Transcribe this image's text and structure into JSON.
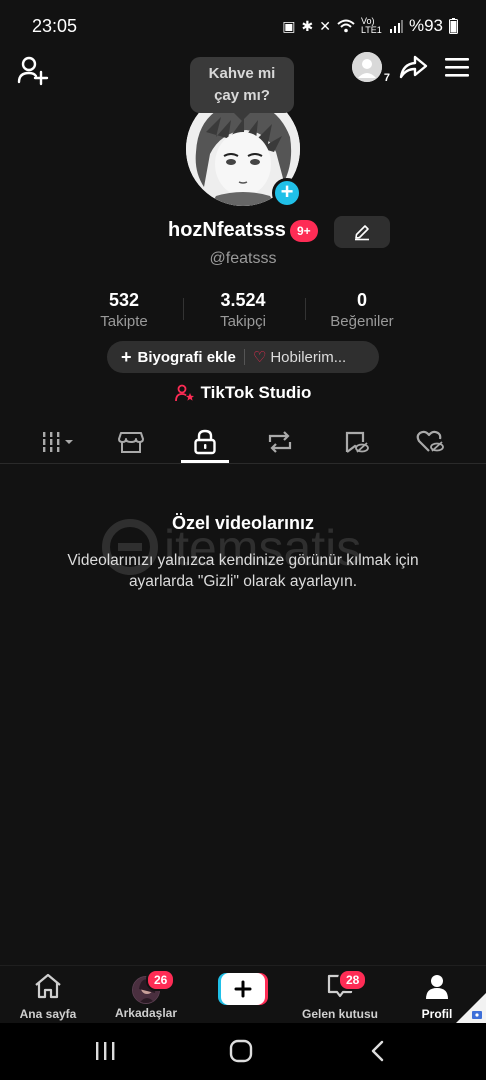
{
  "status": {
    "time": "23:05",
    "network": "Vo) LTE1",
    "battery": "%93"
  },
  "top_bar": {
    "mini_avatar_count": "7"
  },
  "tooltip": {
    "line1": "Kahve mi",
    "line2": "çay mı?"
  },
  "profile": {
    "username": "hozNfeatsss",
    "notif_badge": "9+",
    "handle": "@featsss"
  },
  "stats": [
    {
      "value": "532",
      "label": "Takipte"
    },
    {
      "value": "3.524",
      "label": "Takipçi"
    },
    {
      "value": "0",
      "label": "Beğeniler"
    }
  ],
  "bio": {
    "add_label": "Biyografi ekle",
    "hobby_label": "Hobilerim..."
  },
  "studio_label": "TikTok Studio",
  "tabs": {
    "active_index": 2,
    "icons": [
      "grid-icon",
      "shop-icon",
      "lock-icon",
      "repost-icon",
      "favorites-hidden-icon",
      "liked-hidden-icon"
    ]
  },
  "empty_state": {
    "title": "Özel videolarınız",
    "description": "Videolarınızı yalnızca kendinize görünür kılmak için ayarlarda \"Gizli\" olarak ayarlayın."
  },
  "watermark_text": "itemsatis",
  "bottom_nav": {
    "home": "Ana sayfa",
    "friends": "Arkadaşlar",
    "friends_badge": "26",
    "inbox": "Gelen kutusu",
    "inbox_badge": "28",
    "profile": "Profil"
  },
  "colors": {
    "accent_pink": "#fe2c55",
    "accent_cyan": "#20c0e8",
    "background": "#121212"
  }
}
